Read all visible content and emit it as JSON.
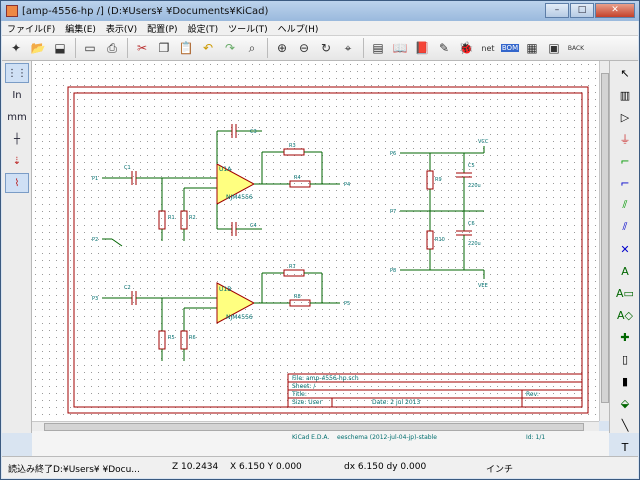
{
  "window": {
    "title": "[amp-4556-hp /] (D:¥Users¥        ¥Documents¥KiCad)",
    "minimize": "–",
    "maximize": "□",
    "close": "✕"
  },
  "menu": [
    {
      "label": "ファイル(F)"
    },
    {
      "label": "編集(E)"
    },
    {
      "label": "表示(V)"
    },
    {
      "label": "配置(P)"
    },
    {
      "label": "設定(T)"
    },
    {
      "label": "ツール(T)"
    },
    {
      "label": "ヘルプ(H)"
    }
  ],
  "toolbar": {
    "net_label": "net",
    "bom_label": "BOM",
    "back_label": "BACK"
  },
  "left_toolbar": {
    "in_label": "In",
    "mm_label": "mm"
  },
  "schematic": {
    "parts": {
      "u1a_ref": "U1A",
      "u1a_val": "NJM4556",
      "u1b_ref": "U1B",
      "u1b_val": "NJM4556",
      "c1": "C1",
      "c2": "C2",
      "c3": "C3",
      "c4": "C4",
      "c5": "C5",
      "c6": "C6",
      "c5_val": "220u",
      "c6_val": "220u",
      "r1": "R1",
      "r2": "R2",
      "r3": "R3",
      "r4": "R4",
      "r5": "R5",
      "r6": "R6",
      "r7": "R7",
      "r8": "R8",
      "r9": "R9",
      "r10": "R10",
      "p1": "P1",
      "p2": "P2",
      "p3": "P3",
      "p4": "P4",
      "p5": "P5",
      "p6": "P6",
      "p7": "P7",
      "p8": "P8",
      "vcc": "VCC",
      "vee": "VEE"
    },
    "title_block": {
      "file": "File: amp-4556-hp.sch",
      "sheet": "Sheet: /",
      "title": "Title:",
      "size": "Size: User",
      "date": "Date: 2 jul 2013",
      "rev": "Rev:",
      "kicad": "KiCad E.D.A.",
      "eeschema": "eeschema (2012-jul-04-jp)-stable",
      "id": "Id: 1/1"
    }
  },
  "status": {
    "message": "読込み終了D:¥Users¥        ¥Docu...",
    "z": "Z 10.2434",
    "xy": "X 6.150  Y 0.000",
    "dxdy": "dx 6.150  dy 0.000",
    "units": "インチ"
  }
}
